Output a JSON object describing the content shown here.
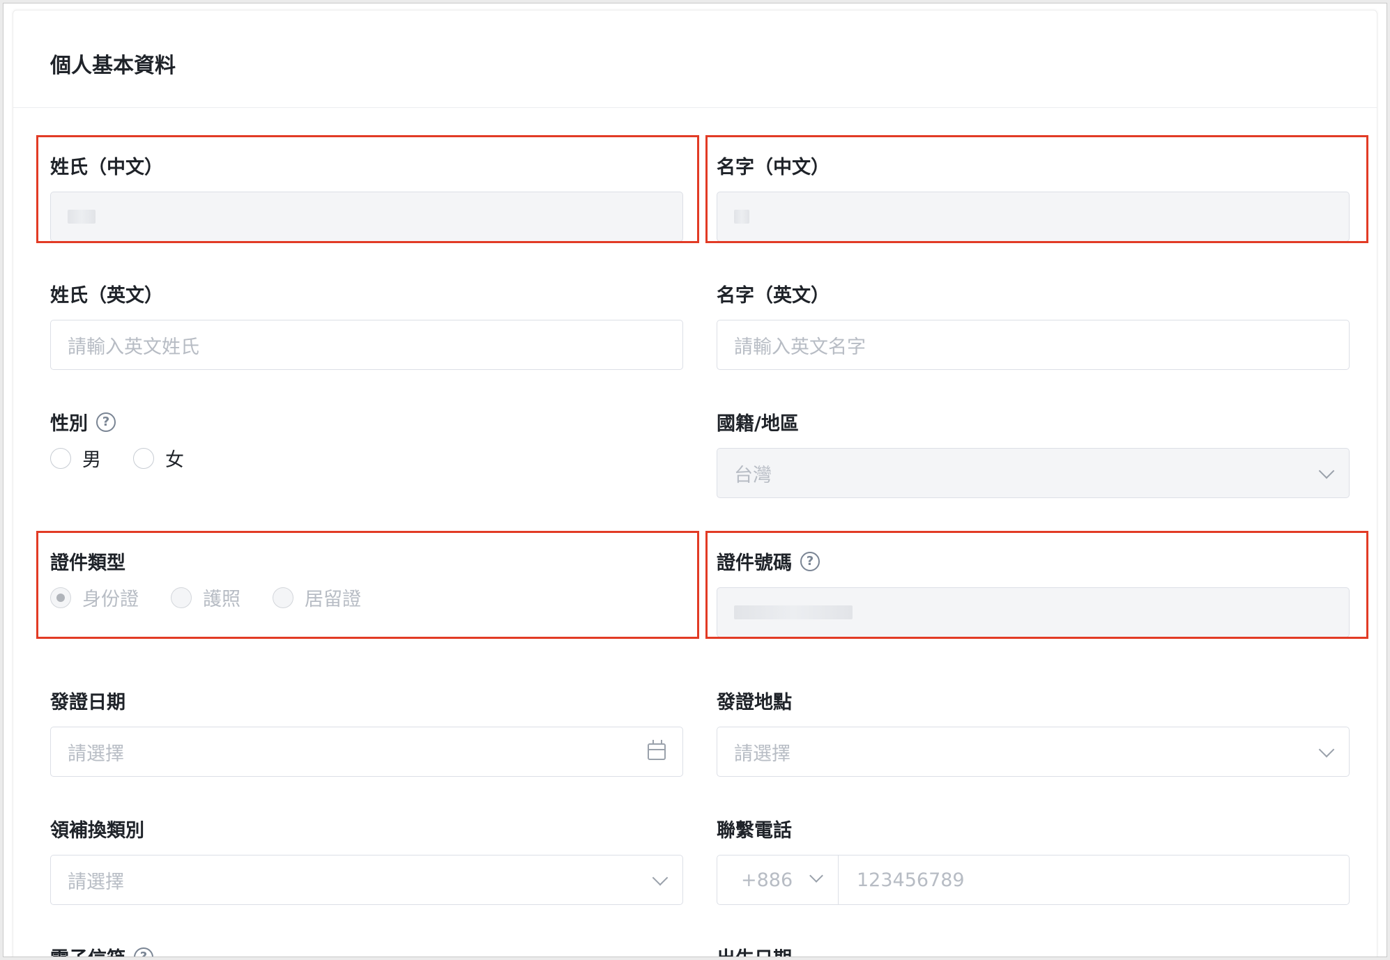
{
  "card": {
    "title": "個人基本資料"
  },
  "fields": {
    "last_name_zh": {
      "label": "姓氏（中文）"
    },
    "first_name_zh": {
      "label": "名字（中文）"
    },
    "last_name_en": {
      "label": "姓氏（英文）",
      "placeholder": "請輸入英文姓氏"
    },
    "first_name_en": {
      "label": "名字（英文）",
      "placeholder": "請輸入英文名字"
    },
    "gender": {
      "label": "性別",
      "options": [
        "男",
        "女"
      ]
    },
    "nationality": {
      "label": "國籍/地區",
      "value": "台灣"
    },
    "id_type": {
      "label": "證件類型",
      "options": [
        "身份證",
        "護照",
        "居留證"
      ],
      "selected": "身份證"
    },
    "id_number": {
      "label": "證件號碼"
    },
    "issue_date": {
      "label": "發證日期",
      "placeholder": "請選擇"
    },
    "issue_place": {
      "label": "發證地點",
      "placeholder": "請選擇"
    },
    "issue_type": {
      "label": "領補換類別",
      "placeholder": "請選擇"
    },
    "phone": {
      "label": "聯繫電話",
      "code": "+886",
      "placeholder": "123456789"
    },
    "email": {
      "label": "電子信箱"
    },
    "birth_date": {
      "label": "出生日期"
    }
  },
  "colors": {
    "highlight": "#e23b25",
    "disabled_bg": "#f4f5f7",
    "border": "#dcdfe6"
  }
}
